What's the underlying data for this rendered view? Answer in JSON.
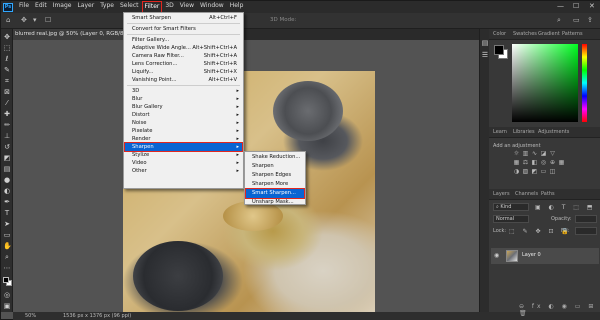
{
  "app": {
    "logo": "Ps"
  },
  "menubar": {
    "items": [
      "File",
      "Edit",
      "Image",
      "Layer",
      "Type",
      "Select",
      "Filter",
      "3D",
      "View",
      "Window",
      "Help"
    ],
    "active_index": 6
  },
  "optionsbar": {
    "mode_label": "3D Mode:"
  },
  "window_controls": {
    "minimize": "—",
    "maximize": "☐",
    "close": "✕"
  },
  "document": {
    "tab_title": "blurred real.jpg @ 50% (Layer 0, RGB/8#)",
    "close_glyph": "×"
  },
  "status": {
    "zoom": "50%",
    "doc_size": "1536 px x 1376 px (96 ppi)"
  },
  "filter_menu": {
    "groups": [
      [
        {
          "label": "Smart Sharpen",
          "shortcut": "Alt+Ctrl+F"
        }
      ],
      [
        {
          "label": "Convert for Smart Filters"
        }
      ],
      [
        {
          "label": "Filter Gallery..."
        },
        {
          "label": "Adaptive Wide Angle...",
          "shortcut": "Alt+Shift+Ctrl+A"
        },
        {
          "label": "Camera Raw Filter...",
          "shortcut": "Shift+Ctrl+A"
        },
        {
          "label": "Lens Correction...",
          "shortcut": "Shift+Ctrl+R"
        },
        {
          "label": "Liquify...",
          "shortcut": "Shift+Ctrl+X"
        },
        {
          "label": "Vanishing Point...",
          "shortcut": "Alt+Ctrl+V"
        }
      ],
      [
        {
          "label": "3D",
          "submenu": true
        },
        {
          "label": "Blur",
          "submenu": true
        },
        {
          "label": "Blur Gallery",
          "submenu": true
        },
        {
          "label": "Distort",
          "submenu": true
        },
        {
          "label": "Noise",
          "submenu": true
        },
        {
          "label": "Pixelate",
          "submenu": true
        },
        {
          "label": "Render",
          "submenu": true
        },
        {
          "label": "Sharpen",
          "submenu": true,
          "highlighted": true
        },
        {
          "label": "Stylize",
          "submenu": true
        },
        {
          "label": "Video",
          "submenu": true
        },
        {
          "label": "Other",
          "submenu": true
        }
      ]
    ],
    "submenu_arrow": "▸"
  },
  "sharpen_submenu": {
    "items": [
      {
        "label": "Shake Reduction..."
      },
      {
        "label": "Sharpen"
      },
      {
        "label": "Sharpen Edges"
      },
      {
        "label": "Sharpen More"
      },
      {
        "label": "Smart Sharpen...",
        "highlighted": true
      },
      {
        "label": "Unsharp Mask..."
      }
    ]
  },
  "color_panel": {
    "tabs": [
      "Color",
      "Swatches",
      "Gradient",
      "Patterns"
    ],
    "active_tab": 0,
    "foreground": "#000000",
    "background": "#ffffff"
  },
  "adjustments_panel": {
    "tabs": [
      "Learn",
      "Libraries",
      "Adjustments"
    ],
    "active_tab": 2,
    "add_label": "Add an adjustment"
  },
  "layers_panel": {
    "tabs": [
      "Layers",
      "Channels",
      "Paths"
    ],
    "active_tab": 0,
    "kind_label": "Kind",
    "blend_mode": "Normal",
    "opacity_label": "Opacity:",
    "lock_label": "Lock:",
    "fill_label": "Fill:",
    "layers": [
      {
        "name": "Layer 0",
        "visible": true
      }
    ]
  },
  "colors": {
    "menu_highlight": "#0a64d2",
    "active_outline": "#e0261f",
    "chrome_dark": "#2b2b2b",
    "canvas_bg": "#535353"
  }
}
